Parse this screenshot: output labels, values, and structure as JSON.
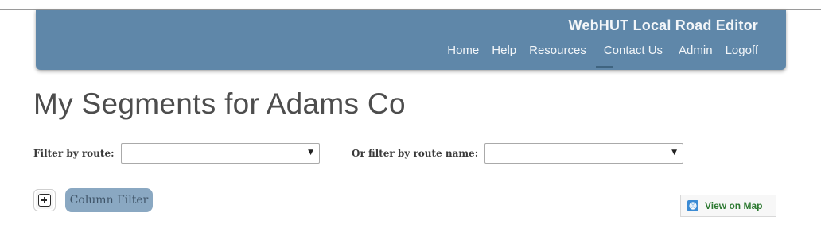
{
  "header": {
    "app_title": "WebHUT Local Road Editor",
    "nav": [
      {
        "label": "Home"
      },
      {
        "label": "Help"
      },
      {
        "label": "Resources"
      },
      {
        "label": "Contact Us"
      },
      {
        "label": "Admin"
      },
      {
        "label": "Logoff"
      }
    ],
    "bg_color": "#5f87a9"
  },
  "page": {
    "title": "My Segments for Adams Co"
  },
  "filters": {
    "route_label": "Filter by route:",
    "route_value": "",
    "route_name_label": "Or filter by route name:",
    "route_name_value": ""
  },
  "toolbar": {
    "expand_icon": "plus-square-icon",
    "column_filter_label": "Column Filter",
    "view_map_icon": "globe-icon",
    "view_map_label": "View on Map"
  }
}
